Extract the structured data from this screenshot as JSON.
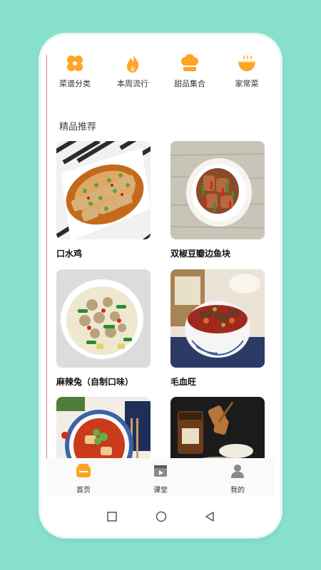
{
  "categories": [
    {
      "label": "菜谱分类",
      "icon": "flower-icon"
    },
    {
      "label": "本周流行",
      "icon": "flame-icon"
    },
    {
      "label": "甜品集合",
      "icon": "cake-icon"
    },
    {
      "label": "家常菜",
      "icon": "bowl-icon"
    }
  ],
  "section_title": "精品推荐",
  "recipes": [
    {
      "title": "口水鸡"
    },
    {
      "title": "双椒豆瓣边鱼块"
    },
    {
      "title": "麻辣兔（自制口味）"
    },
    {
      "title": "毛血旺"
    },
    {
      "title": ""
    },
    {
      "title": ""
    }
  ],
  "tabs": [
    {
      "label": "首页",
      "icon": "home-icon",
      "active": true
    },
    {
      "label": "课堂",
      "icon": "video-icon",
      "active": false
    },
    {
      "label": "我的",
      "icon": "user-icon",
      "active": false
    }
  ],
  "colors": {
    "accent": "#ffa424",
    "background": "#86e0cb"
  }
}
